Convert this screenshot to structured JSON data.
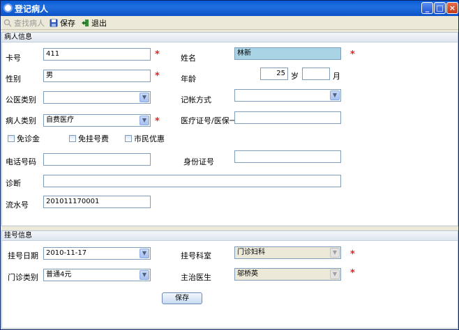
{
  "window": {
    "title": "登记病人"
  },
  "toolbar": {
    "find_label": "查找病人",
    "save_label": "保存",
    "exit_label": "退出"
  },
  "patient": {
    "header": "病人信息",
    "card_no_label": "卡号",
    "card_no_value": "411",
    "name_label": "姓名",
    "name_value": "林新",
    "gender_label": "性别",
    "gender_value": "男",
    "age_label": "年龄",
    "age_years_value": "25",
    "years_unit": "岁",
    "age_months_value": "",
    "months_unit": "月",
    "public_med_label": "公医类别",
    "public_med_value": "",
    "billing_label": "记帐方式",
    "billing_value": "",
    "patient_type_label": "病人类别",
    "patient_type_value": "自费医疗",
    "insurance_label": "医疗证号/医保一",
    "insurance_value": "",
    "fee_waiver_label": "免诊金",
    "reg_fee_waiver_label": "免挂号费",
    "citizen_discount_label": "市民优惠",
    "phone_label": "电话号码",
    "phone_value": "",
    "id_label": "身份证号",
    "id_value": "",
    "diagnosis_label": "诊断",
    "diagnosis_value": "",
    "serial_label": "流水号",
    "serial_value": "201011170001"
  },
  "registration": {
    "header": "挂号信息",
    "date_label": "挂号日期",
    "date_value": "2010-11-17",
    "dept_label": "挂号科室",
    "dept_value": "门诊妇科",
    "clinic_type_label": "门诊类别",
    "clinic_type_value": "普通4元",
    "doctor_label": "主治医生",
    "doctor_value": "邬桥英",
    "save_label": "保存"
  },
  "required_mark": "*"
}
